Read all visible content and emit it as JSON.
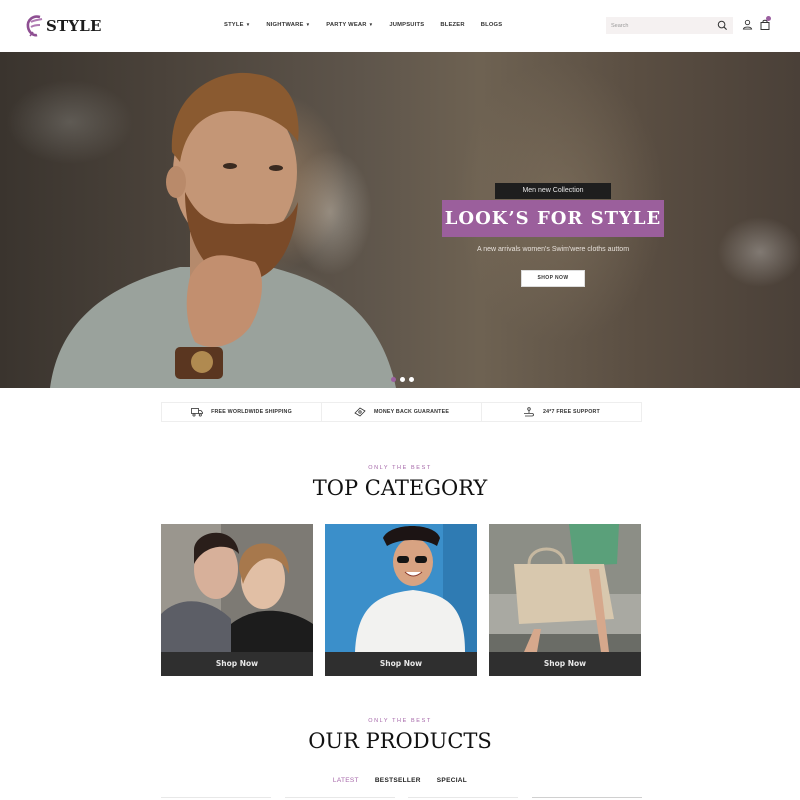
{
  "header": {
    "brand": "STYLE",
    "nav": [
      {
        "label": "STYLE",
        "has_dropdown": true
      },
      {
        "label": "NIGHTWARE",
        "has_dropdown": true
      },
      {
        "label": "PARTY WEAR",
        "has_dropdown": true
      },
      {
        "label": "JUMPSUITS",
        "has_dropdown": false
      },
      {
        "label": "BLEZER",
        "has_dropdown": false
      },
      {
        "label": "BLOGS",
        "has_dropdown": false
      }
    ],
    "caret": "▼",
    "search": {
      "placeholder": "Search",
      "value": ""
    },
    "icons": {
      "search": "search-icon",
      "account": "user-icon",
      "cart": "shopping-bag-icon"
    }
  },
  "hero": {
    "icon": "eyeglasses-icon",
    "subtitle": "Men new Collection",
    "title": "LOOK’S FOR STYLE",
    "description": "A new arrivals women's Swim'were cloths auttom",
    "button": "SHOP NOW",
    "slides": 3,
    "active_slide": 1
  },
  "features": [
    {
      "icon": "truck-icon",
      "label": "FREE WORLDWIDE SHIPPING"
    },
    {
      "icon": "money-icon",
      "label": "MONEY BACK GUARANTEE"
    },
    {
      "icon": "support-hand-icon",
      "label": "24*7 FREE SUPPORT"
    }
  ],
  "top_category": {
    "eyebrow": "ONLY THE BEST",
    "title": "TOP CATEGORY",
    "items": [
      {
        "image": "two women fashion portrait",
        "button": "Shop Now"
      },
      {
        "image": "man in hat and sunglasses against blue wall",
        "button": "Shop Now"
      },
      {
        "image": "woman carrying beige handbag",
        "button": "Shop Now"
      }
    ]
  },
  "products": {
    "eyebrow": "ONLY THE BEST",
    "title": "OUR PRODUCTS",
    "tabs": [
      {
        "label": "LATEST",
        "active": true
      },
      {
        "label": "BESTSELLER",
        "active": false
      },
      {
        "label": "SPECIAL",
        "active": false
      }
    ]
  },
  "colors": {
    "accent": "#9b5f9c",
    "dark_bar": "#2f2f2f",
    "search_bg": "#f5f1f1"
  }
}
